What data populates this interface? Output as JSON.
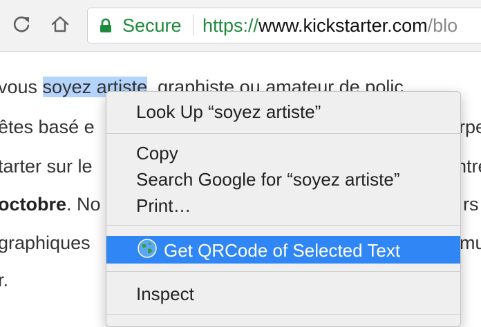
{
  "toolbar": {
    "secure_label": "Secure",
    "url_scheme": "https://",
    "url_host": "www.kickstarter.com",
    "url_path_visible": "/blo"
  },
  "article": {
    "line1_before": "vous ",
    "line1_selected": "soyez artiste",
    "line1_after": ", graphiste ou amateur de polic",
    "line2": "êtes basé e",
    "line2_right": "rpe",
    "line3": "tarter sur le",
    "line3_right": "ntre",
    "line4_bold": "octobre",
    "line4_rest": ". No",
    "line4_right": "rs",
    "line5": "graphiques",
    "line5_right": "mu",
    "line6": "r."
  },
  "context_menu": {
    "items": [
      {
        "label": "Look Up “soyez artiste”"
      },
      {
        "label": "Copy"
      },
      {
        "label": "Search Google for “soyez artiste”"
      },
      {
        "label": "Print…"
      },
      {
        "label": "Get QRCode of Selected Text",
        "highlighted": true,
        "icon": "globe-icon"
      },
      {
        "label": "Inspect"
      }
    ]
  },
  "colors": {
    "secure_green": "#1f8a3c",
    "selection": "#b4d4fb",
    "menu_highlight": "#2f86f4"
  }
}
